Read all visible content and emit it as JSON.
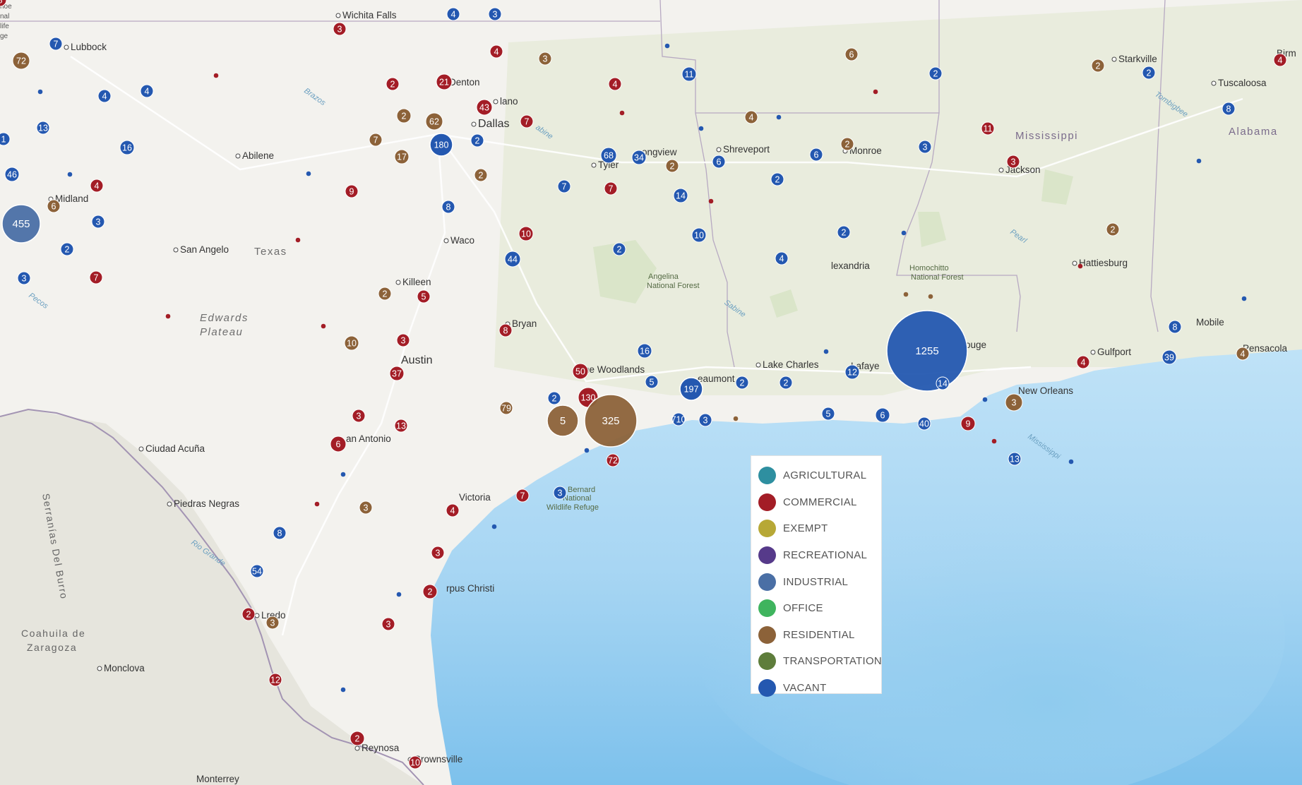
{
  "map": {
    "cities": [
      {
        "name": "Wichita Falls"
      },
      {
        "name": "Lubbock"
      },
      {
        "name": "Denton"
      },
      {
        "name": "lano"
      },
      {
        "name": "Dallas"
      },
      {
        "name": "Abilene"
      },
      {
        "name": "Midland"
      },
      {
        "name": "Tyler"
      },
      {
        "name": "ongview"
      },
      {
        "name": "Shreveport"
      },
      {
        "name": "Monroe"
      },
      {
        "name": "Jackson"
      },
      {
        "name": "Starkville"
      },
      {
        "name": "Tuscaloosa"
      },
      {
        "name": "Birm"
      },
      {
        "name": "San Angelo"
      },
      {
        "name": "Waco"
      },
      {
        "name": "Killeen"
      },
      {
        "name": "Bryan"
      },
      {
        "name": "Austin"
      },
      {
        "name": "he Woodlands"
      },
      {
        "name": "eaumont"
      },
      {
        "name": "Lake Charles"
      },
      {
        "name": "Lafaye"
      },
      {
        "name": "ouge"
      },
      {
        "name": "lexandria"
      },
      {
        "name": "Hattiesburg"
      },
      {
        "name": "Gulfport"
      },
      {
        "name": "Mobile"
      },
      {
        "name": "Pensacola"
      },
      {
        "name": "New Orleans"
      },
      {
        "name": "an Antonio"
      },
      {
        "name": "Ciudad Acuña"
      },
      {
        "name": "Piedras Negras"
      },
      {
        "name": "Victoria"
      },
      {
        "name": "rpus Christi"
      },
      {
        "name": "Lredo"
      },
      {
        "name": "Monclova"
      },
      {
        "name": "Reynosa"
      },
      {
        "name": "Brownsville"
      },
      {
        "name": "Monterrey"
      },
      {
        "name": "hoe"
      },
      {
        "name": "nal"
      },
      {
        "name": "life"
      },
      {
        "name": "ge"
      }
    ],
    "regions": [
      {
        "name": "Texas"
      },
      {
        "name": "Mississippi"
      },
      {
        "name": "Alabama"
      },
      {
        "name": "Edwards"
      },
      {
        "name": "Plateau"
      },
      {
        "name": "Coahuila de"
      },
      {
        "name": "Zaragoza"
      },
      {
        "name": "Serranías Del Burro"
      }
    ],
    "parks": [
      {
        "name": "Angelina"
      },
      {
        "name": "National Forest"
      },
      {
        "name": "Homochitto"
      },
      {
        "name": "National Forest"
      },
      {
        "name": "Bernard"
      },
      {
        "name": "National"
      },
      {
        "name": "Wildlife Refuge"
      }
    ],
    "rivers": [
      {
        "name": "Brazos"
      },
      {
        "name": "abine"
      },
      {
        "name": "Sabine"
      },
      {
        "name": "Pecos"
      },
      {
        "name": "Rio Grande"
      },
      {
        "name": "Pearl"
      },
      {
        "name": "Tombigbee"
      },
      {
        "name": "Mississippi"
      }
    ],
    "markers": [
      {
        "label": "3",
        "cat": "COMMERCIAL"
      },
      {
        "label": "4",
        "cat": "VACANT"
      },
      {
        "label": "3",
        "cat": "VACANT"
      },
      {
        "label": "7",
        "cat": "VACANT"
      },
      {
        "label": "72",
        "cat": "RESIDENTIAL"
      },
      {
        "label": "4",
        "cat": "COMMERCIAL"
      },
      {
        "label": "3",
        "cat": "RESIDENTIAL"
      },
      {
        "label": "4",
        "cat": "VACANT"
      },
      {
        "label": "4",
        "cat": "VACANT"
      },
      {
        "label": "2",
        "cat": "COMMERCIAL"
      },
      {
        "label": "21",
        "cat": "COMMERCIAL"
      },
      {
        "label": "4",
        "cat": "COMMERCIAL"
      },
      {
        "label": "6",
        "cat": "RESIDENTIAL"
      },
      {
        "label": "11",
        "cat": "VACANT"
      },
      {
        "label": "2",
        "cat": "VACANT"
      },
      {
        "label": "2",
        "cat": "RESIDENTIAL"
      },
      {
        "label": "2",
        "cat": "VACANT"
      },
      {
        "label": "4",
        "cat": "COMMERCIAL"
      },
      {
        "label": "13",
        "cat": "VACANT"
      },
      {
        "label": "2",
        "cat": "RESIDENTIAL"
      },
      {
        "label": "62",
        "cat": "RESIDENTIAL"
      },
      {
        "label": "43",
        "cat": "COMMERCIAL"
      },
      {
        "label": "7",
        "cat": "COMMERCIAL"
      },
      {
        "label": "4",
        "cat": "RESIDENTIAL"
      },
      {
        "label": "8",
        "cat": "VACANT"
      },
      {
        "label": "11",
        "cat": "COMMERCIAL"
      },
      {
        "label": "1",
        "cat": "VACANT"
      },
      {
        "label": "16",
        "cat": "VACANT"
      },
      {
        "label": "7",
        "cat": "RESIDENTIAL"
      },
      {
        "label": "180",
        "cat": "VACANT"
      },
      {
        "label": "2",
        "cat": "VACANT"
      },
      {
        "label": "17",
        "cat": "RESIDENTIAL"
      },
      {
        "label": "68",
        "cat": "VACANT"
      },
      {
        "label": "34",
        "cat": "VACANT"
      },
      {
        "label": "2",
        "cat": "RESIDENTIAL"
      },
      {
        "label": "6",
        "cat": "VACANT"
      },
      {
        "label": "6",
        "cat": "VACANT"
      },
      {
        "label": "2",
        "cat": "RESIDENTIAL"
      },
      {
        "label": "3",
        "cat": "VACANT"
      },
      {
        "label": "3",
        "cat": "COMMERCIAL"
      },
      {
        "label": "46",
        "cat": "VACANT"
      },
      {
        "label": "4",
        "cat": "COMMERCIAL"
      },
      {
        "label": "2",
        "cat": "RESIDENTIAL"
      },
      {
        "label": "9",
        "cat": "COMMERCIAL"
      },
      {
        "label": "7",
        "cat": "VACANT"
      },
      {
        "label": "7",
        "cat": "COMMERCIAL"
      },
      {
        "label": "14",
        "cat": "VACANT"
      },
      {
        "label": "2",
        "cat": "VACANT"
      },
      {
        "label": "6",
        "cat": "RESIDENTIAL"
      },
      {
        "label": "8",
        "cat": "VACANT"
      },
      {
        "label": "455",
        "cat": "INDUSTRIAL"
      },
      {
        "label": "3",
        "cat": "VACANT"
      },
      {
        "label": "10",
        "cat": "COMMERCIAL"
      },
      {
        "label": "2",
        "cat": "VACANT"
      },
      {
        "label": "2",
        "cat": "VACANT"
      },
      {
        "label": "10",
        "cat": "VACANT"
      },
      {
        "label": "2",
        "cat": "RESIDENTIAL"
      },
      {
        "label": "2",
        "cat": "VACANT"
      },
      {
        "label": "44",
        "cat": "VACANT"
      },
      {
        "label": "4",
        "cat": "VACANT"
      },
      {
        "label": "3",
        "cat": "VACANT"
      },
      {
        "label": "7",
        "cat": "COMMERCIAL"
      },
      {
        "label": "2",
        "cat": "RESIDENTIAL"
      },
      {
        "label": "5",
        "cat": "COMMERCIAL"
      },
      {
        "label": "8",
        "cat": "COMMERCIAL"
      },
      {
        "label": "10",
        "cat": "RESIDENTIAL"
      },
      {
        "label": "3",
        "cat": "COMMERCIAL"
      },
      {
        "label": "16",
        "cat": "VACANT"
      },
      {
        "label": "8",
        "cat": "VACANT"
      },
      {
        "label": "4",
        "cat": "RESIDENTIAL"
      },
      {
        "label": "37",
        "cat": "COMMERCIAL"
      },
      {
        "label": "50",
        "cat": "COMMERCIAL"
      },
      {
        "label": "1255",
        "cat": "VACANT"
      },
      {
        "label": "4",
        "cat": "COMMERCIAL"
      },
      {
        "label": "39",
        "cat": "VACANT"
      },
      {
        "label": "12",
        "cat": "VACANT"
      },
      {
        "label": "2",
        "cat": "VACANT"
      },
      {
        "label": "2",
        "cat": "VACANT"
      },
      {
        "label": "197",
        "cat": "VACANT"
      },
      {
        "label": "5",
        "cat": "VACANT"
      },
      {
        "label": "130",
        "cat": "COMMERCIAL"
      },
      {
        "label": "14",
        "cat": "VACANT"
      },
      {
        "label": "2",
        "cat": "VACANT"
      },
      {
        "label": "3",
        "cat": "RESIDENTIAL"
      },
      {
        "label": "79",
        "cat": "RESIDENTIAL"
      },
      {
        "label": "3",
        "cat": "COMMERCIAL"
      },
      {
        "label": "5",
        "cat": "RESIDENTIAL"
      },
      {
        "label": "325",
        "cat": "RESIDENTIAL"
      },
      {
        "label": "710",
        "cat": "VACANT"
      },
      {
        "label": "3",
        "cat": "VACANT"
      },
      {
        "label": "5",
        "cat": "VACANT"
      },
      {
        "label": "6",
        "cat": "VACANT"
      },
      {
        "label": "40",
        "cat": "VACANT"
      },
      {
        "label": "9",
        "cat": "COMMERCIAL"
      },
      {
        "label": "13",
        "cat": "COMMERCIAL"
      },
      {
        "label": "6",
        "cat": "COMMERCIAL"
      },
      {
        "label": "72",
        "cat": "COMMERCIAL"
      },
      {
        "label": "13",
        "cat": "VACANT"
      },
      {
        "label": "3",
        "cat": "RESIDENTIAL"
      },
      {
        "label": "4",
        "cat": "COMMERCIAL"
      },
      {
        "label": "7",
        "cat": "COMMERCIAL"
      },
      {
        "label": "3",
        "cat": "VACANT"
      },
      {
        "label": "8",
        "cat": "VACANT"
      },
      {
        "label": "3",
        "cat": "COMMERCIAL"
      },
      {
        "label": "2",
        "cat": "COMMERCIAL"
      },
      {
        "label": "54",
        "cat": "VACANT"
      },
      {
        "label": "2",
        "cat": "COMMERCIAL"
      },
      {
        "label": "3",
        "cat": "RESIDENTIAL"
      },
      {
        "label": "3",
        "cat": "COMMERCIAL"
      },
      {
        "label": "12",
        "cat": "COMMERCIAL"
      },
      {
        "label": "2",
        "cat": "COMMERCIAL"
      },
      {
        "label": "10",
        "cat": "COMMERCIAL"
      },
      {
        "label": "8",
        "cat": "COMMERCIAL"
      }
    ]
  },
  "legend": {
    "items": [
      {
        "label": "AGRICULTURAL",
        "color": "#2e8fa0"
      },
      {
        "label": "COMMERCIAL",
        "color": "#a31d26"
      },
      {
        "label": "EXEMPT",
        "color": "#b7a836"
      },
      {
        "label": "RECREATIONAL",
        "color": "#563a8a"
      },
      {
        "label": "INDUSTRIAL",
        "color": "#4a6fa5"
      },
      {
        "label": "OFFICE",
        "color": "#3fb45e"
      },
      {
        "label": "RESIDENTIAL",
        "color": "#8c6239"
      },
      {
        "label": "TRANSPORTATION",
        "color": "#5e7d3b"
      },
      {
        "label": "VACANT",
        "color": "#2458b0"
      }
    ]
  }
}
